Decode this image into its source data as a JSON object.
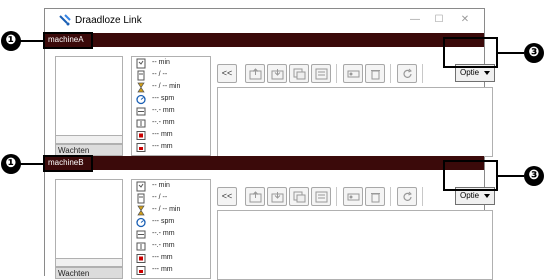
{
  "window": {
    "title": "Draadloze Link",
    "minimize_glyph": "—",
    "maximize_glyph": "☐",
    "close_glyph": "✕"
  },
  "panels": [
    {
      "machine_name": "machineA",
      "status": "Wachten",
      "stats": [
        "-- min",
        "-- / --",
        "-- / -- min",
        "--- spm",
        "--.- mm",
        "--.- mm",
        "--- mm",
        "--- mm"
      ],
      "option_label": "Optie"
    },
    {
      "machine_name": "machineB",
      "status": "Wachten",
      "stats": [
        "-- min",
        "-- / --",
        "-- / -- min",
        "--- spm",
        "--.- mm",
        "--.- mm",
        "--- mm",
        "--- mm"
      ],
      "option_label": "Optie"
    }
  ],
  "toolbar": {
    "collapse_label": "<<"
  },
  "callouts": {
    "marker_1": "❶",
    "marker_3": "❸"
  },
  "icons": {
    "stats": [
      "time-icon",
      "count-icon",
      "hourglass-icon",
      "speed-icon",
      "width-icon",
      "height-icon",
      "size-x-icon",
      "size-y-icon"
    ],
    "toolbar": [
      "upload-icon",
      "download-icon",
      "send-icon",
      "receive-icon",
      "machine-send-icon",
      "delete-icon",
      "refresh-icon"
    ]
  }
}
